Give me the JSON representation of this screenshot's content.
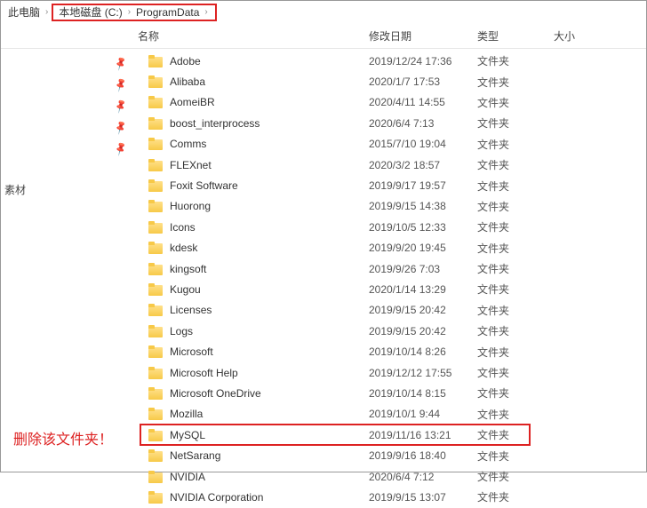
{
  "breadcrumb": {
    "root": "此电脑",
    "seg1": "本地磁盘 (C:)",
    "seg2": "ProgramData"
  },
  "columns": {
    "name": "名称",
    "date": "修改日期",
    "type": "类型",
    "size": "大小"
  },
  "quick_access": {
    "item1": "素材"
  },
  "folder_type": "文件夹",
  "folders": [
    {
      "name": "Adobe",
      "date": "2019/12/24 17:36"
    },
    {
      "name": "Alibaba",
      "date": "2020/1/7 17:53"
    },
    {
      "name": "AomeiBR",
      "date": "2020/4/11 14:55"
    },
    {
      "name": "boost_interprocess",
      "date": "2020/6/4 7:13"
    },
    {
      "name": "Comms",
      "date": "2015/7/10 19:04"
    },
    {
      "name": "FLEXnet",
      "date": "2020/3/2 18:57"
    },
    {
      "name": "Foxit Software",
      "date": "2019/9/17 19:57"
    },
    {
      "name": "Huorong",
      "date": "2019/9/15 14:38"
    },
    {
      "name": "Icons",
      "date": "2019/10/5 12:33"
    },
    {
      "name": "kdesk",
      "date": "2019/9/20 19:45"
    },
    {
      "name": "kingsoft",
      "date": "2019/9/26 7:03"
    },
    {
      "name": "Kugou",
      "date": "2020/1/14 13:29"
    },
    {
      "name": "Licenses",
      "date": "2019/9/15 20:42"
    },
    {
      "name": "Logs",
      "date": "2019/9/15 20:42"
    },
    {
      "name": "Microsoft",
      "date": "2019/10/14 8:26"
    },
    {
      "name": "Microsoft Help",
      "date": "2019/12/12 17:55"
    },
    {
      "name": "Microsoft OneDrive",
      "date": "2019/10/14 8:15"
    },
    {
      "name": "Mozilla",
      "date": "2019/10/1 9:44"
    },
    {
      "name": "MySQL",
      "date": "2019/11/16 13:21"
    },
    {
      "name": "NetSarang",
      "date": "2019/9/16 18:40"
    },
    {
      "name": "NVIDIA",
      "date": "2020/6/4 7:12"
    },
    {
      "name": "NVIDIA Corporation",
      "date": "2019/9/15 13:07"
    }
  ],
  "annotation": "删除该文件夹！",
  "colors": {
    "accent_red": "#d22",
    "folder_yellow": "#f7c948"
  }
}
